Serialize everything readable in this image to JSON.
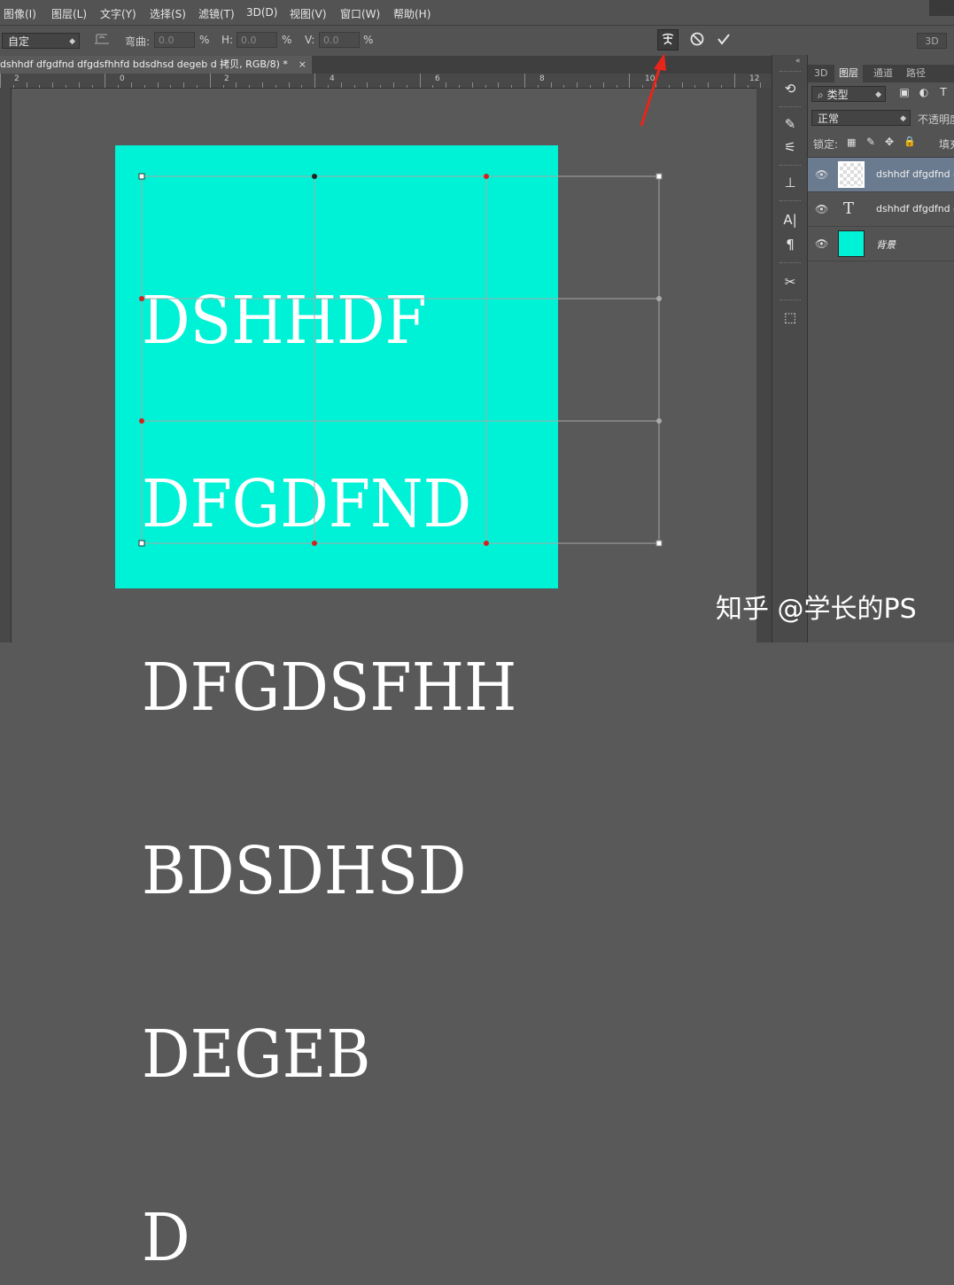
{
  "menu": {
    "items": [
      "图像(I)",
      "图层(L)",
      "文字(Y)",
      "选择(S)",
      "滤镜(T)",
      "3D(D)",
      "视图(V)",
      "窗口(W)",
      "帮助(H)"
    ]
  },
  "options": {
    "preset": "自定",
    "bend_label": "弯曲:",
    "bend_value": "0.0",
    "h_label": "H:",
    "h_value": "0.0",
    "v_label": "V:",
    "v_value": "0.0",
    "percent": "%",
    "mode_3d": "3D"
  },
  "document": {
    "tab_title": "dshhdf dfgdfnd dfgdsfhhfd bdsdhsd degeb d 拷贝, RGB/8) *",
    "close_glyph": "×",
    "canvas_color": "#00f2d6",
    "text_lines": [
      "DSHHDF",
      "DFGDFND",
      "DFGDSFHH",
      "BDSDHSD",
      "DEGEB",
      "D"
    ]
  },
  "ruler": {
    "labels": [
      "2",
      "0",
      "2",
      "4",
      "6",
      "8",
      "10",
      "12"
    ]
  },
  "layers_panel": {
    "tabs": [
      "3D",
      "图层",
      "通道",
      "路径"
    ],
    "filter_kind": "类型",
    "blend_mode": "正常",
    "opacity_label": "不透明度",
    "lock_label": "锁定:",
    "fill_label": "填充",
    "layers": [
      {
        "name": "dshhdf dfgdfnd d",
        "type": "smart",
        "selected": true
      },
      {
        "name": "dshhdf dfgdfnd d",
        "type": "text",
        "selected": false
      },
      {
        "name": "背景",
        "type": "background",
        "selected": false
      }
    ]
  },
  "watermark": "知乎 @学长的PS"
}
